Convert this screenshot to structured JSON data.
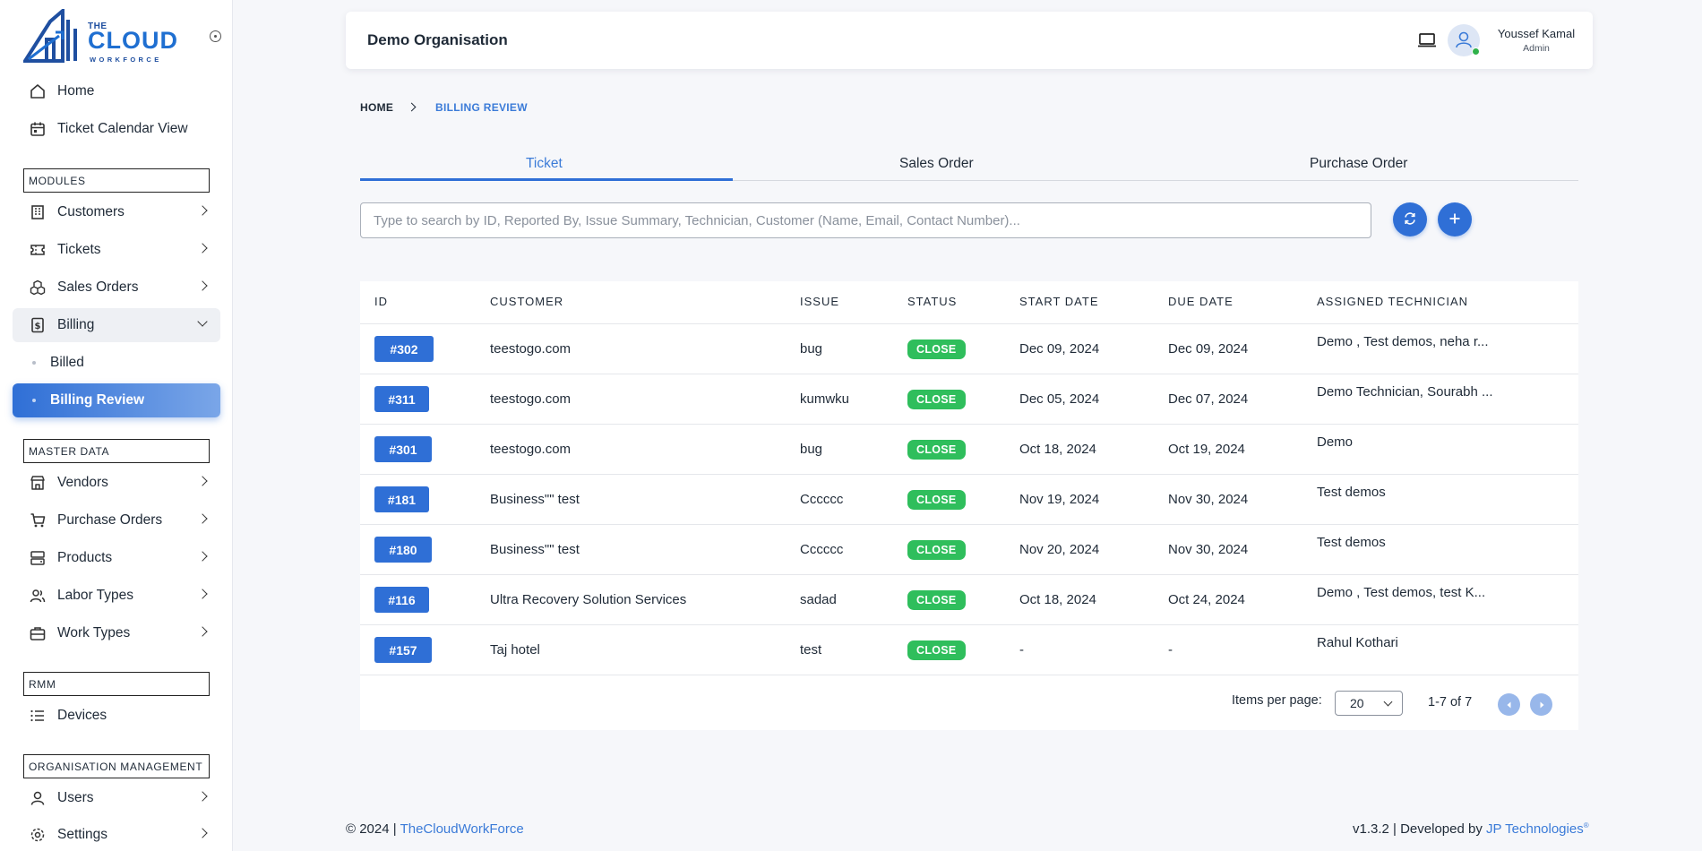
{
  "brand": {
    "line1": "THE",
    "line2": "CLOUD",
    "line3": "WORKFORCE"
  },
  "sidebar": {
    "top_items": [
      {
        "label": "Home",
        "icon": "home-icon"
      },
      {
        "label": "Ticket Calendar View",
        "icon": "calendar-icon"
      }
    ],
    "sections": {
      "modules": "MODULES",
      "master_data": "MASTER DATA",
      "rmm": "RMM",
      "org_management": "ORGANISATION MANAGEMENT"
    },
    "modules": [
      {
        "label": "Customers",
        "icon": "building-icon"
      },
      {
        "label": "Tickets",
        "icon": "ticket-icon"
      },
      {
        "label": "Sales Orders",
        "icon": "boxes-icon"
      },
      {
        "label": "Billing",
        "icon": "billing-icon"
      }
    ],
    "billing_sub": [
      {
        "label": "Billed"
      },
      {
        "label": "Billing Review"
      }
    ],
    "master_data": [
      {
        "label": "Vendors",
        "icon": "store-icon"
      },
      {
        "label": "Purchase Orders",
        "icon": "cart-icon"
      },
      {
        "label": "Products",
        "icon": "products-icon"
      },
      {
        "label": "Labor Types",
        "icon": "users-icon"
      },
      {
        "label": "Work Types",
        "icon": "briefcase-icon"
      }
    ],
    "rmm": [
      {
        "label": "Devices",
        "icon": "list-icon"
      }
    ],
    "org_management": [
      {
        "label": "Users",
        "icon": "user-icon"
      },
      {
        "label": "Settings",
        "icon": "gear-icon"
      }
    ]
  },
  "header": {
    "org_name": "Demo Organisation",
    "user_name": "Youssef Kamal",
    "user_role": "Admin"
  },
  "breadcrumb": {
    "home": "HOME",
    "current": "BILLING REVIEW"
  },
  "tabs": [
    "Ticket",
    "Sales Order",
    "Purchase Order"
  ],
  "search": {
    "placeholder": "Type to search by ID, Reported By, Issue Summary, Technician, Customer (Name, Email, Contact Number)...",
    "value": ""
  },
  "table": {
    "columns": [
      "ID",
      "CUSTOMER",
      "ISSUE",
      "STATUS",
      "START DATE",
      "DUE DATE",
      "ASSIGNED TECHNICIAN"
    ],
    "rows": [
      {
        "id": "#302",
        "customer": "teestogo.com",
        "issue": "bug",
        "status": "CLOSE",
        "start": "Dec 09, 2024",
        "due": "Dec 09, 2024",
        "tech": "Demo , Test demos, neha r..."
      },
      {
        "id": "#311",
        "customer": "teestogo.com",
        "issue": "kumwku",
        "status": "CLOSE",
        "start": "Dec 05, 2024",
        "due": "Dec 07, 2024",
        "tech": "Demo Technician, Sourabh ..."
      },
      {
        "id": "#301",
        "customer": "teestogo.com",
        "issue": "bug",
        "status": "CLOSE",
        "start": "Oct 18, 2024",
        "due": "Oct 19, 2024",
        "tech": "Demo"
      },
      {
        "id": "#181",
        "customer": "Business\"\" test",
        "issue": "Cccccc",
        "status": "CLOSE",
        "start": "Nov 19, 2024",
        "due": "Nov 30, 2024",
        "tech": "Test demos"
      },
      {
        "id": "#180",
        "customer": "Business\"\" test",
        "issue": "Cccccc",
        "status": "CLOSE",
        "start": "Nov 20, 2024",
        "due": "Nov 30, 2024",
        "tech": "Test demos"
      },
      {
        "id": "#116",
        "customer": "Ultra Recovery Solution Services",
        "issue": "sadad",
        "status": "CLOSE",
        "start": "Oct 18, 2024",
        "due": "Oct 24, 2024",
        "tech": "Demo , Test demos, test K..."
      },
      {
        "id": "#157",
        "customer": "Taj hotel",
        "issue": "test",
        "status": "CLOSE",
        "start": "-",
        "due": "-",
        "tech": "Rahul Kothari"
      }
    ]
  },
  "pagination": {
    "label": "Items per page:",
    "per_page": "20",
    "range": "1-7 of 7"
  },
  "footer": {
    "copyright": "© 2024 |",
    "brand_link": "TheCloudWorkForce",
    "version": "v1.3.2 | Developed by",
    "dev_link": "JP Technologies",
    "reg": "®"
  },
  "colors": {
    "accent": "#2f6fd6",
    "status_close": "#2fbe5c",
    "link": "#3b7bd8"
  }
}
